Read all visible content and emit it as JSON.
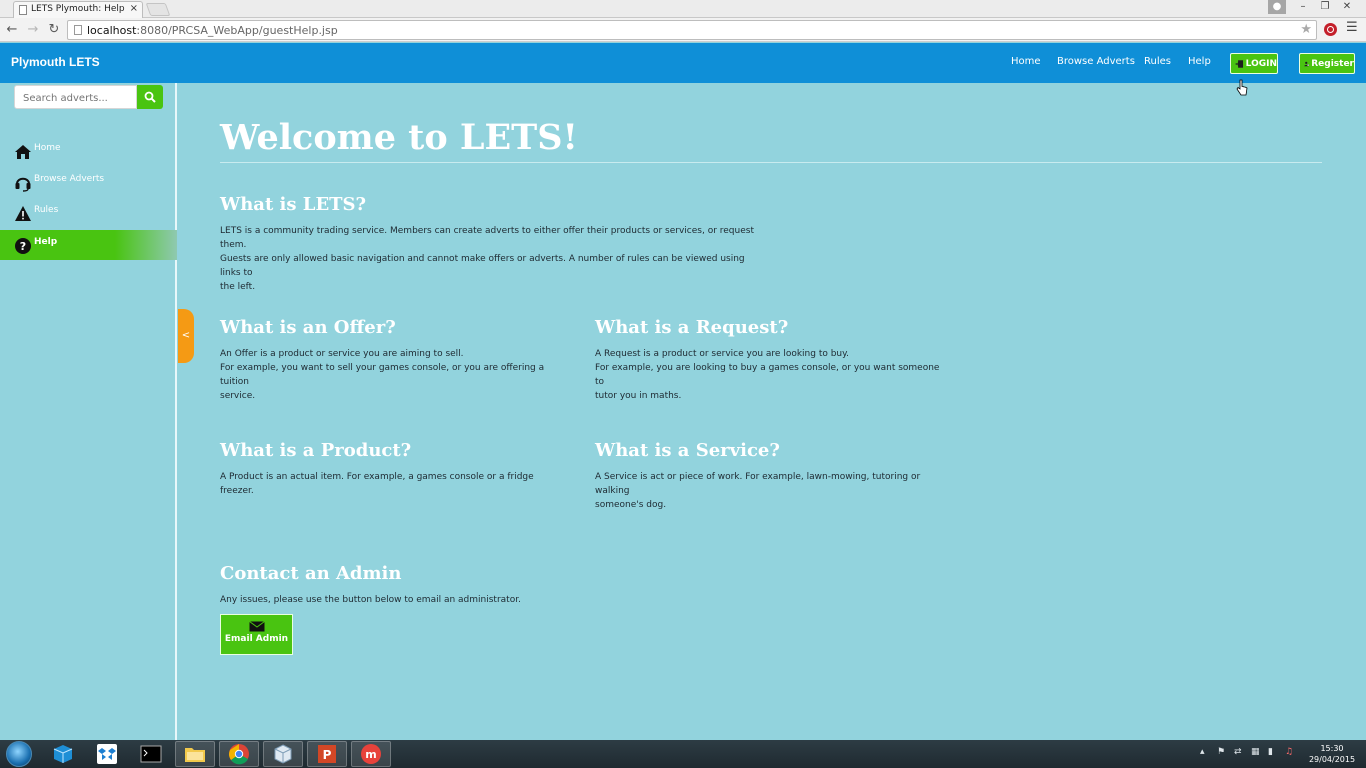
{
  "browser": {
    "tab_title": "LETS Plymouth: Help",
    "tab_close": "×",
    "url_host": "localhost",
    "url_rest": ":8080/PRCSA_WebApp/guestHelp.jsp",
    "window_controls": [
      "–",
      "❐",
      "✕"
    ]
  },
  "header": {
    "brand": "Plymouth LETS",
    "nav": [
      {
        "label": "Home"
      },
      {
        "label": "Browse Adverts"
      },
      {
        "label": "Rules"
      },
      {
        "label": "Help"
      }
    ],
    "login_label": "LOGIN",
    "register_label": "Register"
  },
  "sidebar": {
    "search_placeholder": "Search adverts...",
    "items": [
      {
        "label": "Home",
        "icon": "home-icon"
      },
      {
        "label": "Browse Adverts",
        "icon": "headset-icon"
      },
      {
        "label": "Rules",
        "icon": "warning-icon"
      },
      {
        "label": "Help",
        "icon": "question-icon",
        "active": true
      }
    ],
    "collapse_label": "<"
  },
  "main": {
    "title": "Welcome to LETS!",
    "what_is_lets": {
      "heading": "What is LETS?",
      "lines": [
        "LETS is a community trading service. Members can create adverts to either offer their products or services, or request them.",
        "Guests are only allowed basic navigation and cannot make offers or adverts. A number of rules can be viewed using links to",
        "the left."
      ]
    },
    "offer": {
      "heading": "What is an Offer?",
      "lines": [
        "An Offer is a product or service you are aiming to sell.",
        "For example, you want to sell your games console, or you are offering a tuition",
        "service."
      ]
    },
    "request": {
      "heading": "What is a Request?",
      "lines": [
        "A Request is a product or service you are looking to buy.",
        "For example, you are looking to buy a games console, or you want someone to",
        "tutor you in maths."
      ]
    },
    "product": {
      "heading": "What is a Product?",
      "lines": [
        "A Product is an actual item. For example, a games console or a fridge freezer."
      ]
    },
    "service": {
      "heading": "What is a Service?",
      "lines": [
        "A Service is act or piece of work. For example, lawn-mowing, tutoring or walking",
        "someone's dog."
      ]
    },
    "contact": {
      "heading": "Contact an Admin",
      "text": "Any issues, please use the button below to email an administrator.",
      "button_label": "Email Admin"
    }
  },
  "taskbar": {
    "time": "15:30",
    "date": "29/04/2015"
  },
  "colors": {
    "page_bg": "#92d3dd",
    "navbar": "#0f8fd7",
    "accent_green": "#49c411",
    "collapse_tab": "#f59a14"
  }
}
